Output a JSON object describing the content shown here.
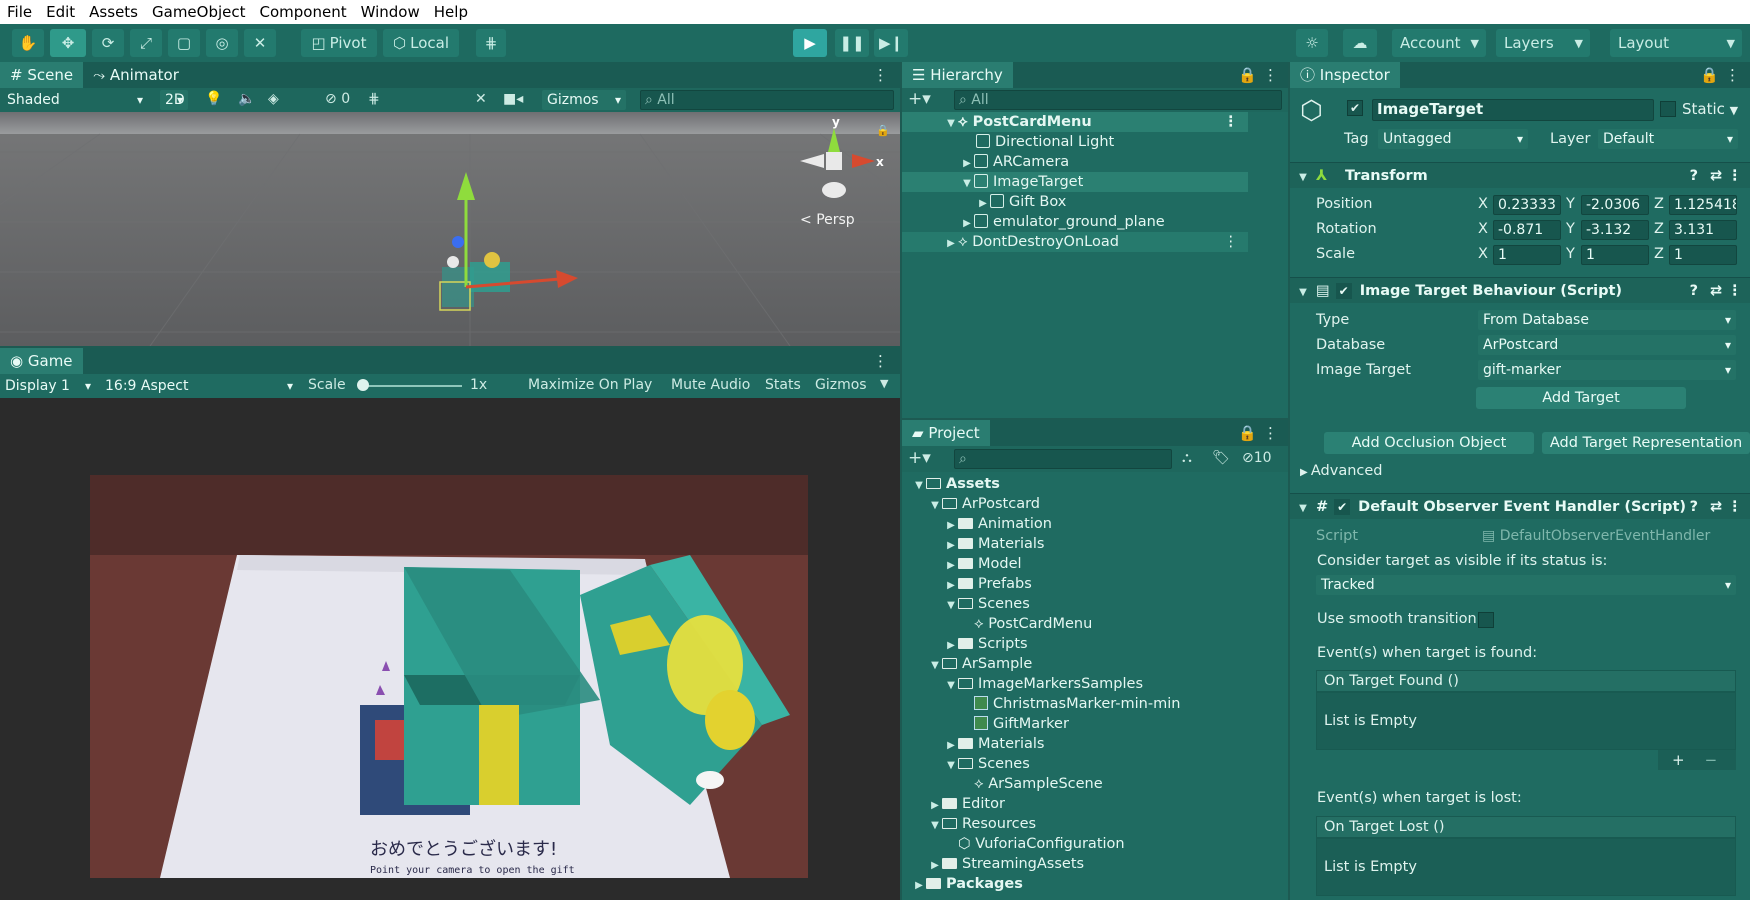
{
  "menu": [
    "File",
    "Edit",
    "Assets",
    "GameObject",
    "Component",
    "Window",
    "Help"
  ],
  "toolbar": {
    "pivot": "Pivot",
    "local": "Local",
    "account": "Account",
    "layers": "Layers",
    "layout": "Layout"
  },
  "scene": {
    "tab": "Scene",
    "tab2": "Animator",
    "shading": "Shaded",
    "mode2d": "2D",
    "hidden_count": "0",
    "gizmos": "Gizmos",
    "search_placeholder": "All",
    "persp": "Persp",
    "axis_y": "y",
    "axis_x": "x"
  },
  "game": {
    "tab": "Game",
    "display": "Display 1",
    "aspect": "16:9 Aspect",
    "scale_label": "Scale",
    "scale_value": "1x",
    "maximize": "Maximize On Play",
    "mute": "Mute Audio",
    "stats": "Stats",
    "gizmos": "Gizmos",
    "card_text": "おめでとうございます!",
    "card_sub": "Point your camera to open the gift"
  },
  "hierarchy": {
    "tab": "Hierarchy",
    "search_placeholder": "All",
    "items": [
      {
        "label": "PostCardMenu",
        "depth": 0
      },
      {
        "label": "Directional Light",
        "depth": 1
      },
      {
        "label": "ARCamera",
        "depth": 1
      },
      {
        "label": "ImageTarget",
        "depth": 1
      },
      {
        "label": "Gift Box",
        "depth": 2
      },
      {
        "label": "emulator_ground_plane",
        "depth": 1
      },
      {
        "label": "DontDestroyOnLoad",
        "depth": 0
      }
    ]
  },
  "project": {
    "tab": "Project",
    "hidden_count": "10",
    "items": [
      {
        "label": "Assets",
        "depth": 0,
        "kind": "folder-open",
        "bold": true
      },
      {
        "label": "ArPostcard",
        "depth": 1,
        "kind": "folder-open"
      },
      {
        "label": "Animation",
        "depth": 2,
        "kind": "folder"
      },
      {
        "label": "Materials",
        "depth": 2,
        "kind": "folder"
      },
      {
        "label": "Model",
        "depth": 2,
        "kind": "folder"
      },
      {
        "label": "Prefabs",
        "depth": 2,
        "kind": "folder"
      },
      {
        "label": "Scenes",
        "depth": 2,
        "kind": "folder-open"
      },
      {
        "label": "PostCardMenu",
        "depth": 3,
        "kind": "scene"
      },
      {
        "label": "Scripts",
        "depth": 2,
        "kind": "folder"
      },
      {
        "label": "ArSample",
        "depth": 1,
        "kind": "folder-open"
      },
      {
        "label": "ImageMarkersSamples",
        "depth": 2,
        "kind": "folder-open"
      },
      {
        "label": "ChristmasMarker-min-min",
        "depth": 3,
        "kind": "image"
      },
      {
        "label": "GiftMarker",
        "depth": 3,
        "kind": "image"
      },
      {
        "label": "Materials",
        "depth": 2,
        "kind": "folder"
      },
      {
        "label": "Scenes",
        "depth": 2,
        "kind": "folder-open"
      },
      {
        "label": "ArSampleScene",
        "depth": 3,
        "kind": "scene"
      },
      {
        "label": "Editor",
        "depth": 1,
        "kind": "folder"
      },
      {
        "label": "Resources",
        "depth": 1,
        "kind": "folder-open"
      },
      {
        "label": "VuforiaConfiguration",
        "depth": 2,
        "kind": "asset"
      },
      {
        "label": "StreamingAssets",
        "depth": 1,
        "kind": "folder"
      },
      {
        "label": "Packages",
        "depth": 0,
        "kind": "folder",
        "bold": true
      }
    ]
  },
  "inspector": {
    "tab": "Inspector",
    "object_name": "ImageTarget",
    "static": "Static",
    "tag_label": "Tag",
    "tag": "Untagged",
    "layer_label": "Layer",
    "layer": "Default",
    "transform": {
      "title": "Transform",
      "position_label": "Position",
      "rotation_label": "Rotation",
      "scale_label": "Scale",
      "position": {
        "x": "0.23333",
        "y": "-2.0306",
        "z": "1.125418"
      },
      "rotation": {
        "x": "-0.871",
        "y": "-3.132",
        "z": "3.131"
      },
      "scale": {
        "x": "1",
        "y": "1",
        "z": "1"
      }
    },
    "itb": {
      "title": "Image Target Behaviour (Script)",
      "type_label": "Type",
      "type": "From Database",
      "database_label": "Database",
      "database": "ArPostcard",
      "target_label": "Image Target",
      "target": "gift-marker",
      "add_target": "Add Target",
      "add_occlusion": "Add Occlusion Object",
      "add_repr": "Add Target Representation",
      "advanced": "Advanced"
    },
    "doeh": {
      "title": "Default Observer Event Handler (Script)",
      "script_label": "Script",
      "script": "DefaultObserverEventHandler",
      "consider": "Consider target as visible if its status is:",
      "status": "Tracked",
      "smooth": "Use smooth transition",
      "found_label": "Event(s) when target is found:",
      "found_event": "On Target Found ()",
      "found_empty": "List is Empty",
      "lost_label": "Event(s) when target is lost:",
      "lost_event": "On Target Lost ()",
      "lost_empty": "List is Empty"
    }
  },
  "axis_labels": {
    "x": "X",
    "y": "Y",
    "z": "Z"
  }
}
